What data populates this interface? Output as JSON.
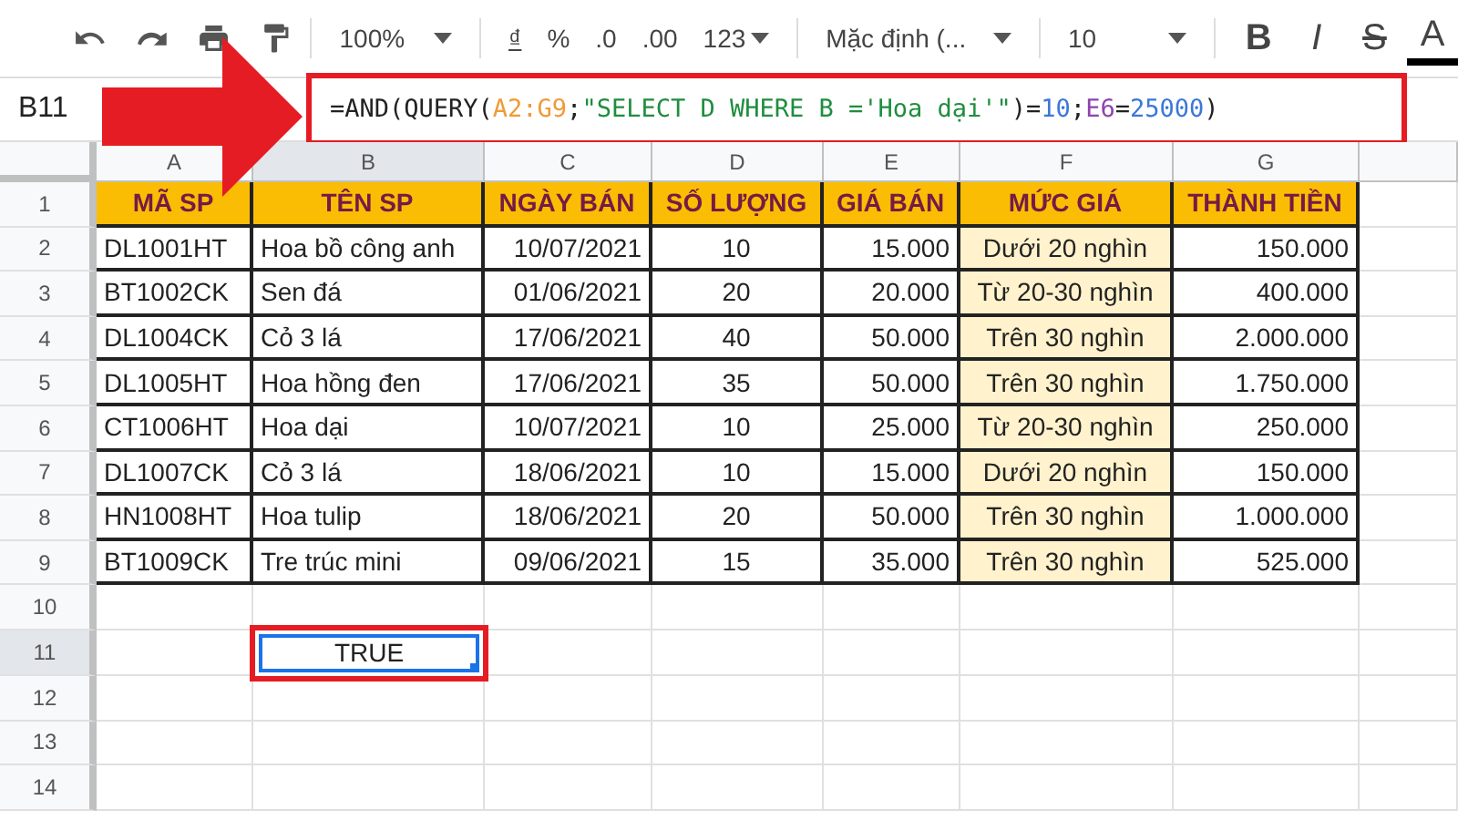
{
  "toolbar": {
    "zoom": "100%",
    "currency": "₫",
    "percent": "%",
    "decimal_less": ".0",
    "decimal_more": ".00",
    "format": "123",
    "font": "Mặc định (...",
    "font_size": "10",
    "bold": "B",
    "italic": "I",
    "strike": "S",
    "text_color": "A"
  },
  "formula_bar": {
    "cell_ref": "B11",
    "tokens": [
      {
        "text": "=AND(QUERY(",
        "color": "#222222"
      },
      {
        "text": "A2:G9",
        "color": "#f09a37"
      },
      {
        "text": ";",
        "color": "#222222"
      },
      {
        "text": "\"SELECT D WHERE B ='Hoa dại'\"",
        "color": "#1e8e3e"
      },
      {
        "text": ")=",
        "color": "#222222"
      },
      {
        "text": "10",
        "color": "#3c78d8"
      },
      {
        "text": ";",
        "color": "#222222"
      },
      {
        "text": "E6",
        "color": "#8e44ad"
      },
      {
        "text": "=",
        "color": "#222222"
      },
      {
        "text": "25000",
        "color": "#3c78d8"
      },
      {
        "text": ")",
        "color": "#222222"
      }
    ]
  },
  "columns": [
    {
      "label": "A",
      "selected": false
    },
    {
      "label": "B",
      "selected": true
    },
    {
      "label": "C",
      "selected": false
    },
    {
      "label": "D",
      "selected": false
    },
    {
      "label": "E",
      "selected": false
    },
    {
      "label": "F",
      "selected": false,
      "color": "#fff2cc"
    },
    {
      "label": "G",
      "selected": false
    }
  ],
  "rows": [
    {
      "number": "1",
      "kind": "header",
      "selected": false,
      "cells": [
        "MÃ SP",
        "TÊN SP",
        "NGÀY BÁN",
        "SỐ LƯỢNG",
        "GIÁ BÁN",
        "MỨC GIÁ",
        "THÀNH TIỀN"
      ]
    },
    {
      "number": "2",
      "kind": "data",
      "selected": false,
      "cells": [
        "DL1001HT",
        "Hoa bồ công anh",
        "10/07/2021",
        "10",
        "15.000",
        "Dưới 20 nghìn",
        "150.000"
      ]
    },
    {
      "number": "3",
      "kind": "data",
      "selected": false,
      "cells": [
        "BT1002CK",
        "Sen đá",
        "01/06/2021",
        "20",
        "20.000",
        "Từ 20-30 nghìn",
        "400.000"
      ]
    },
    {
      "number": "4",
      "kind": "data",
      "selected": false,
      "cells": [
        "DL1004CK",
        "Cỏ 3 lá",
        "17/06/2021",
        "40",
        "50.000",
        "Trên 30 nghìn",
        "2.000.000"
      ]
    },
    {
      "number": "5",
      "kind": "data",
      "selected": false,
      "cells": [
        "DL1005HT",
        "Hoa hồng đen",
        "17/06/2021",
        "35",
        "50.000",
        "Trên 30 nghìn",
        "1.750.000"
      ]
    },
    {
      "number": "6",
      "kind": "data",
      "selected": false,
      "cells": [
        "CT1006HT",
        "Hoa dại",
        "10/07/2021",
        "10",
        "25.000",
        "Từ 20-30 nghìn",
        "250.000"
      ]
    },
    {
      "number": "7",
      "kind": "data",
      "selected": false,
      "cells": [
        "DL1007CK",
        "Cỏ 3 lá",
        "18/06/2021",
        "10",
        "15.000",
        "Dưới 20 nghìn",
        "150.000"
      ]
    },
    {
      "number": "8",
      "kind": "data",
      "selected": false,
      "cells": [
        "HN1008HT",
        "Hoa tulip",
        "18/06/2021",
        "20",
        "50.000",
        "Trên 30 nghìn",
        "1.000.000"
      ]
    },
    {
      "number": "9",
      "kind": "data",
      "selected": false,
      "cells": [
        "BT1009CK",
        "Tre trúc mini",
        "09/06/2021",
        "15",
        "35.000",
        "Trên 30 nghìn",
        "525.000"
      ]
    },
    {
      "number": "10",
      "kind": "empty",
      "selected": false
    },
    {
      "number": "11",
      "kind": "empty",
      "selected": true,
      "cells": [
        null,
        {
          "text": "TRUE",
          "selected": true
        }
      ]
    },
    {
      "number": "12",
      "kind": "empty",
      "selected": false
    },
    {
      "number": "13",
      "kind": "empty",
      "selected": false
    },
    {
      "number": "14",
      "kind": "empty",
      "selected": false
    }
  ]
}
